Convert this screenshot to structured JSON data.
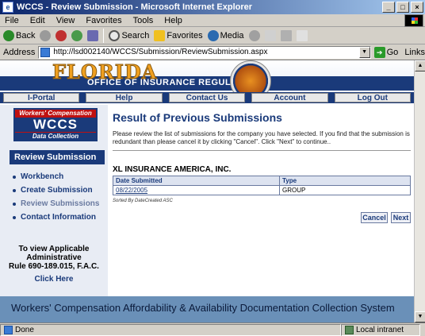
{
  "window": {
    "title": "WCCS - Review Submission - Microsoft Internet Explorer",
    "minimize": "_",
    "maximize": "□",
    "close": "×"
  },
  "menu": [
    "File",
    "Edit",
    "View",
    "Favorites",
    "Tools",
    "Help"
  ],
  "toolbar": {
    "back": "Back",
    "search": "Search",
    "favorites": "Favorites",
    "media": "Media"
  },
  "address": {
    "label": "Address",
    "url": "http://lsd002140/WCCS/Submission/ReviewSubmission.aspx",
    "go": "Go",
    "links": "Links"
  },
  "banner": {
    "state": "FLORIDA",
    "office": "OFFICE OF INSURANCE REGULATION"
  },
  "nav": [
    "I-Portal",
    "Help",
    "Contact Us",
    "Account",
    "Log Out"
  ],
  "logo": {
    "top": "Workers' Compensation",
    "mid": "WCCS",
    "bottom": "Data Collection"
  },
  "sidebar": {
    "heading": "Review Submission",
    "items": [
      {
        "label": "Workbench",
        "active": true
      },
      {
        "label": "Create Submission",
        "active": true
      },
      {
        "label": "Review Submissions",
        "active": false
      },
      {
        "label": "Contact Information",
        "active": true
      }
    ],
    "note_line1": "To view Applicable",
    "note_line2": "Administrative",
    "note_line3": "Rule 690-189.015, F.A.C.",
    "link": "Click Here"
  },
  "main": {
    "title": "Result of Previous Submissions",
    "intro": "Please review the list of submissions for the company you have selected. If you find that the submission is redundant than please cancel it by clicking \"Cancel\". Click \"Next\" to continue..",
    "company": "XL INSURANCE AMERICA, INC.",
    "columns": [
      "Date Submitted",
      "Type"
    ],
    "rows": [
      {
        "date": "08/22/2005",
        "type": "GROUP"
      }
    ],
    "sort_note": "Sorted By DateCreated ASC",
    "cancel": "Cancel",
    "next": "Next"
  },
  "footer": "Workers' Compensation Affordability & Availability Documentation Collection System",
  "status": {
    "left": "Done",
    "zone": "Local intranet"
  }
}
